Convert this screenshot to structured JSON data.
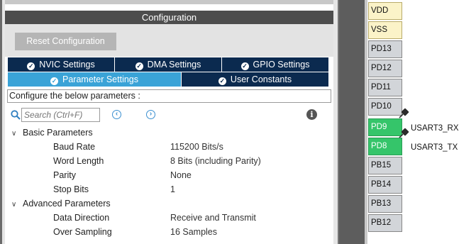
{
  "panel": {
    "title": "Configuration",
    "reset_label": "Reset Configuration",
    "tabs_row1": [
      "NVIC Settings",
      "DMA Settings",
      "GPIO Settings"
    ],
    "tabs_row2": [
      "Parameter Settings",
      "User Constants"
    ],
    "active_tab": "Parameter Settings",
    "configure_text": "Configure the below parameters :",
    "search_placeholder": "Search (Ctrl+F)"
  },
  "groups": [
    {
      "name": "Basic Parameters",
      "params": [
        {
          "name": "Baud Rate",
          "value": "115200 Bits/s"
        },
        {
          "name": "Word Length",
          "value": "8 Bits (including Parity)"
        },
        {
          "name": "Parity",
          "value": "None"
        },
        {
          "name": "Stop Bits",
          "value": "1"
        }
      ]
    },
    {
      "name": "Advanced Parameters",
      "params": [
        {
          "name": "Data Direction",
          "value": "Receive and Transmit"
        },
        {
          "name": "Over Sampling",
          "value": "16 Samples"
        }
      ]
    }
  ],
  "pins": [
    {
      "label": "VDD",
      "kind": "power",
      "signal": ""
    },
    {
      "label": "VSS",
      "kind": "power",
      "signal": ""
    },
    {
      "label": "PD13",
      "kind": "gray",
      "signal": ""
    },
    {
      "label": "PD12",
      "kind": "gray",
      "signal": ""
    },
    {
      "label": "PD11",
      "kind": "gray",
      "signal": ""
    },
    {
      "label": "PD10",
      "kind": "gray",
      "signal": ""
    },
    {
      "label": "PD9",
      "kind": "green",
      "signal": "USART3_RX"
    },
    {
      "label": "PD8",
      "kind": "green",
      "signal": "USART3_TX"
    },
    {
      "label": "PB15",
      "kind": "gray",
      "signal": ""
    },
    {
      "label": "PB14",
      "kind": "gray",
      "signal": ""
    },
    {
      "label": "PB13",
      "kind": "gray",
      "signal": ""
    },
    {
      "label": "PB12",
      "kind": "gray",
      "signal": ""
    }
  ],
  "colors": {
    "tab_dark": "#0b2a4f",
    "tab_active": "#3aa3d7",
    "pin_green": "#35c56a",
    "pin_power": "#fbf3c8",
    "pin_gray": "#d2d5d9"
  }
}
